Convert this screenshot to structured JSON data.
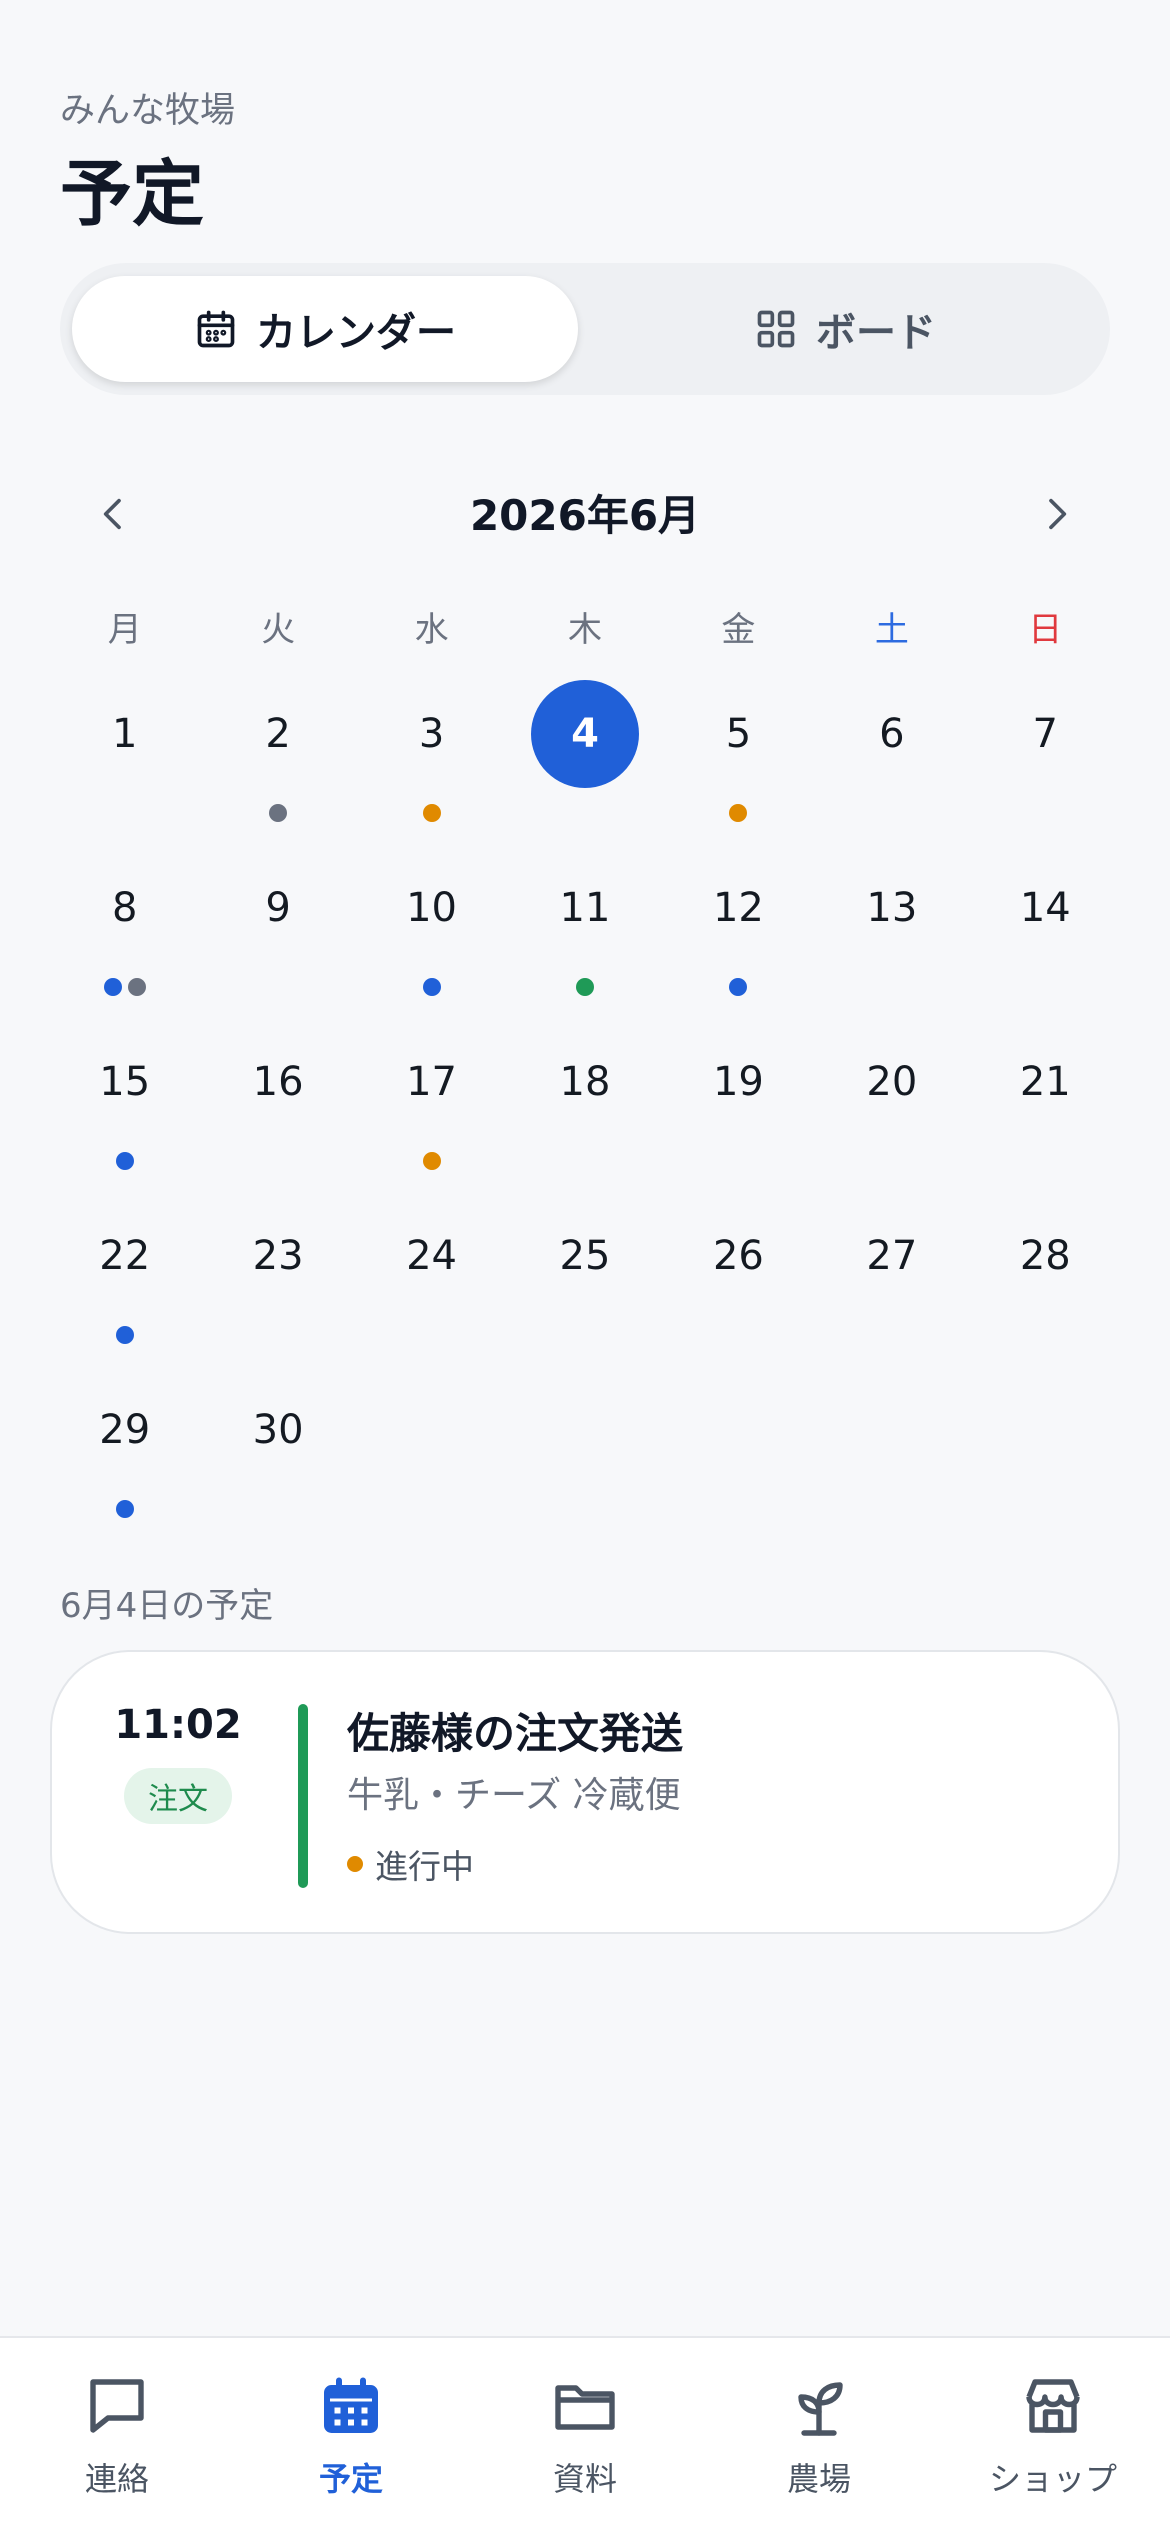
{
  "header": {
    "app_name": "みんな牧場",
    "page_title": "予定"
  },
  "view_toggle": {
    "options": [
      {
        "label": "カレンダー",
        "icon": "calendar-icon",
        "selected": true
      },
      {
        "label": "ボード",
        "icon": "grid-icon",
        "selected": false
      }
    ]
  },
  "calendar": {
    "month_label": "2026年6月",
    "weekdays": [
      "月",
      "火",
      "水",
      "木",
      "金",
      "土",
      "日"
    ],
    "today": 4,
    "days": [
      {
        "day": "1",
        "dots": []
      },
      {
        "day": "2",
        "dots": [
          "#6b7280"
        ]
      },
      {
        "day": "3",
        "dots": [
          "#e08a00"
        ]
      },
      {
        "day": "4",
        "dots": []
      },
      {
        "day": "5",
        "dots": [
          "#e08a00"
        ]
      },
      {
        "day": "6",
        "dots": []
      },
      {
        "day": "7",
        "dots": []
      },
      {
        "day": "8",
        "dots": [
          "#2060d8",
          "#6b7280"
        ]
      },
      {
        "day": "9",
        "dots": []
      },
      {
        "day": "10",
        "dots": [
          "#2060d8"
        ]
      },
      {
        "day": "11",
        "dots": [
          "#1f9a57"
        ]
      },
      {
        "day": "12",
        "dots": [
          "#2060d8"
        ]
      },
      {
        "day": "13",
        "dots": []
      },
      {
        "day": "14",
        "dots": []
      },
      {
        "day": "15",
        "dots": [
          "#2060d8"
        ]
      },
      {
        "day": "16",
        "dots": []
      },
      {
        "day": "17",
        "dots": [
          "#e08a00"
        ]
      },
      {
        "day": "18",
        "dots": []
      },
      {
        "day": "19",
        "dots": []
      },
      {
        "day": "20",
        "dots": []
      },
      {
        "day": "21",
        "dots": []
      },
      {
        "day": "22",
        "dots": [
          "#2060d8"
        ]
      },
      {
        "day": "23",
        "dots": []
      },
      {
        "day": "24",
        "dots": []
      },
      {
        "day": "25",
        "dots": []
      },
      {
        "day": "26",
        "dots": []
      },
      {
        "day": "27",
        "dots": []
      },
      {
        "day": "28",
        "dots": []
      },
      {
        "day": "29",
        "dots": [
          "#2060d8"
        ]
      },
      {
        "day": "30",
        "dots": []
      }
    ]
  },
  "selected_day": {
    "label": "6月4日の予定",
    "events": [
      {
        "time": "11:02",
        "tag": "注文",
        "title": "佐藤様の注文発送",
        "description": "牛乳・チーズ 冷蔵便",
        "status": "進行中",
        "status_color": "#e08a00",
        "accent_color": "#1f9a57"
      }
    ]
  },
  "tab_bar": {
    "items": [
      {
        "label": "連絡",
        "icon": "chat-bubble-icon",
        "active": false
      },
      {
        "label": "予定",
        "icon": "calendar-icon",
        "active": true
      },
      {
        "label": "資料",
        "icon": "folder-icon",
        "active": false
      },
      {
        "label": "農場",
        "icon": "sprout-icon",
        "active": false
      },
      {
        "label": "ショップ",
        "icon": "store-icon",
        "active": false
      }
    ]
  },
  "colors": {
    "accent": "#2060d8",
    "saturday": "#2d6be0",
    "sunday": "#e0393e"
  }
}
